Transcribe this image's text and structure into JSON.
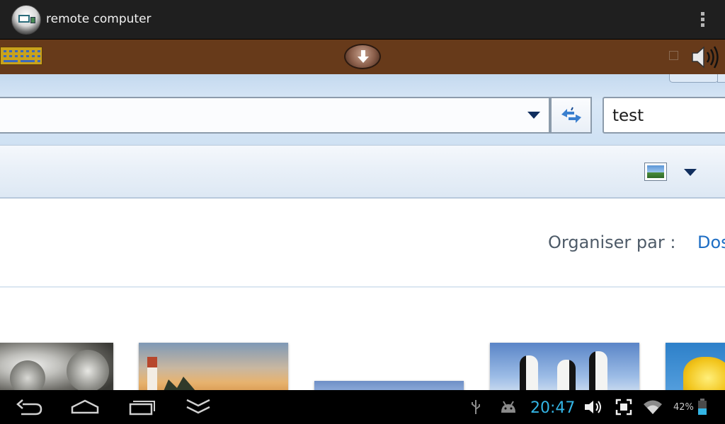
{
  "app": {
    "title": "remote computer",
    "icon": "remote-computer-icon",
    "menu_icon": "overflow-menu-icon"
  },
  "toolbar": {
    "keyboard_icon": "keyboard-icon",
    "download_icon": "download-arrow-icon",
    "sound_icon": "speaker-icon",
    "background_color": "#673a1a"
  },
  "explorer": {
    "address_value": "",
    "search_value": "test",
    "arrange_label": "Organiser par :",
    "arrange_value": "Dos",
    "thumbnails": [
      "koala",
      "lighthouse",
      "sky",
      "penguins",
      "tulips"
    ]
  },
  "system_bar": {
    "time": "20:47",
    "battery": "42%",
    "clock_color": "#33b5e5"
  }
}
